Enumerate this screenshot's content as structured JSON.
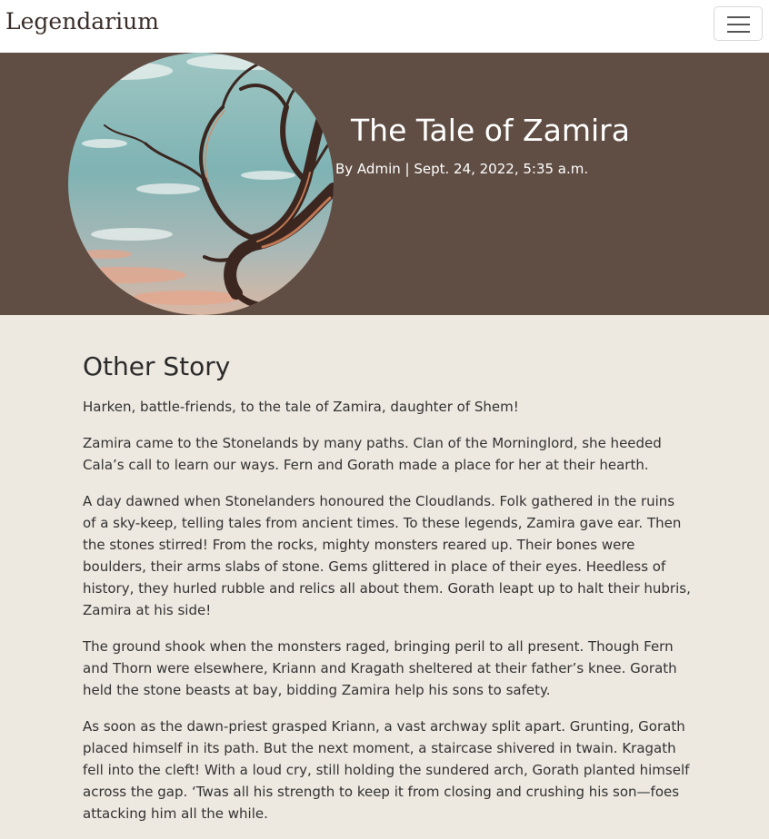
{
  "navbar": {
    "brand": "Legendarium",
    "toggle_icon": "hamburger-menu-icon"
  },
  "hero": {
    "image_description_icon": "tree-branches-sky-image",
    "title": "The Tale of Zamira",
    "meta": "By Admin | Sept. 24, 2022, 5:35 a.m.",
    "background_color": "#604e44"
  },
  "content": {
    "heading": "Other Story",
    "paragraphs": [
      "Harken, battle-friends, to the tale of Zamira, daughter of Shem!",
      "Zamira came to the Stonelands by many paths.  Clan of the Morninglord, she heeded Cala’s call to learn our ways.  Fern and Gorath made a place for her at their hearth.",
      "A day dawned when Stonelanders honoured the Cloudlands.  Folk gathered in the ruins of a sky-keep, telling tales from ancient times.  To these legends, Zamira gave ear.  Then the stones stirred!  From the rocks, mighty monsters reared up.  Their bones were boulders, their arms slabs of stone.  Gems glittered in place of their eyes.  Heedless of history, they hurled rubble and relics all about them.  Gorath leapt up to halt their hubris, Zamira at his side!",
      "The ground shook when the monsters raged, bringing peril to all present.  Though Fern and Thorn were elsewhere, Kriann and Kragath sheltered at their father’s knee.  Gorath held the stone beasts at bay, bidding Zamira help his sons to safety.",
      "As soon as the dawn-priest grasped Kriann, a vast archway split apart.  Grunting, Gorath placed himself in its path.  But the next moment, a staircase shivered in twain.  Kragath fell into the cleft!  With a loud cry, still holding the sundered arch, Gorath planted himself across the gap.  ‘Twas all his strength to keep it from closing and crushing his son—foes attacking him all the while."
    ]
  }
}
